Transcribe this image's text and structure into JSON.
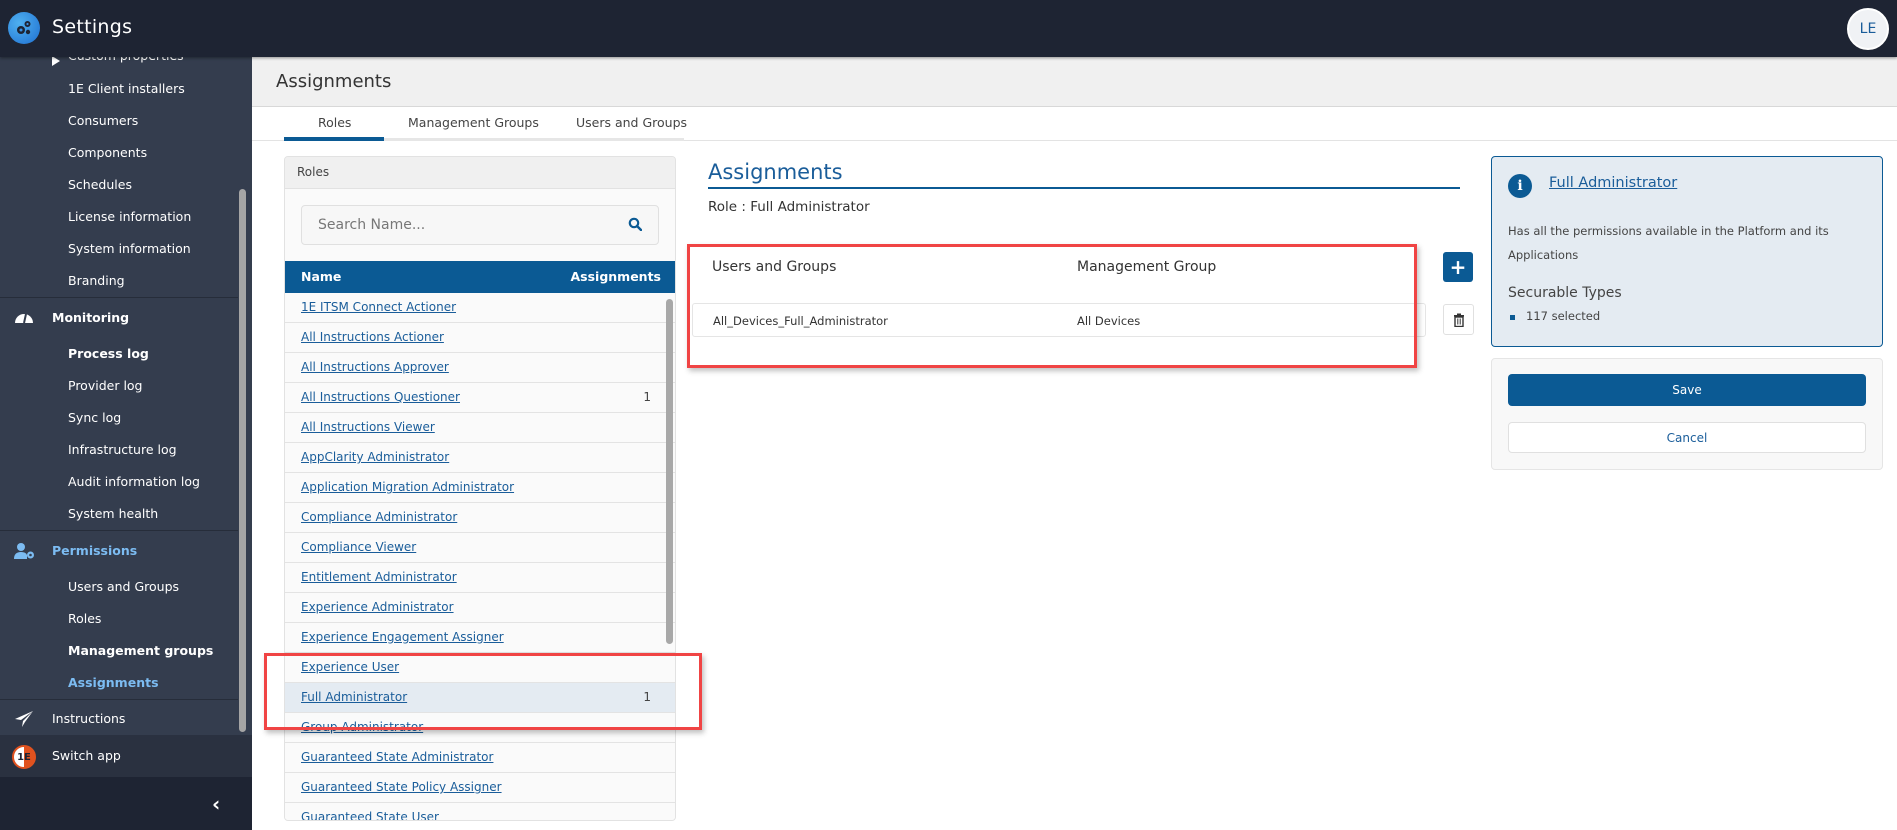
{
  "app": {
    "title": "Settings",
    "user_initials": "LE"
  },
  "sidebar": {
    "partial_item": "Custom properties",
    "settings_items": [
      "1E Client installers",
      "Consumers",
      "Components",
      "Schedules",
      "License information",
      "System information",
      "Branding"
    ],
    "monitoring": {
      "label": "Monitoring",
      "items": [
        "Process log",
        "Provider log",
        "Sync log",
        "Infrastructure log",
        "Audit information log",
        "System health"
      ]
    },
    "permissions": {
      "label": "Permissions",
      "items": [
        "Users and Groups",
        "Roles",
        "Management groups",
        "Assignments"
      ],
      "active_item": "Assignments"
    },
    "instructions_label": "Instructions",
    "switch_app_label": "Switch app",
    "collapse_icon": "chevron-left-icon"
  },
  "page": {
    "title": "Assignments",
    "tabs": [
      {
        "label": "Roles",
        "active": true
      },
      {
        "label": "Management Groups",
        "active": false
      },
      {
        "label": "Users and Groups",
        "active": false
      }
    ]
  },
  "roles_panel": {
    "title": "Roles",
    "search_placeholder": "Search Name...",
    "columns": {
      "name": "Name",
      "assignments": "Assignments"
    },
    "rows": [
      {
        "name": "1E ITSM Connect Actioner",
        "count": ""
      },
      {
        "name": "All Instructions Actioner",
        "count": ""
      },
      {
        "name": "All Instructions Approver",
        "count": ""
      },
      {
        "name": "All Instructions Questioner",
        "count": "1"
      },
      {
        "name": "All Instructions Viewer",
        "count": ""
      },
      {
        "name": "AppClarity Administrator",
        "count": ""
      },
      {
        "name": "Application Migration Administrator",
        "count": ""
      },
      {
        "name": "Compliance Administrator",
        "count": ""
      },
      {
        "name": "Compliance Viewer",
        "count": ""
      },
      {
        "name": "Entitlement Administrator",
        "count": ""
      },
      {
        "name": "Experience Administrator",
        "count": ""
      },
      {
        "name": "Experience Engagement Assigner",
        "count": ""
      },
      {
        "name": "Experience User",
        "count": ""
      },
      {
        "name": "Full Administrator",
        "count": "1",
        "selected": true
      },
      {
        "name": "Group Administrator",
        "count": ""
      },
      {
        "name": "Guaranteed State Administrator",
        "count": ""
      },
      {
        "name": "Guaranteed State Policy Assigner",
        "count": ""
      },
      {
        "name": "Guaranteed State User",
        "count": ""
      }
    ]
  },
  "assignments": {
    "title": "Assignments",
    "role_line": "Role : Full Administrator",
    "columns": {
      "users_groups": "Users and Groups",
      "management_group": "Management Group"
    },
    "rows": [
      {
        "users_groups": "All_Devices_Full_Administrator",
        "management_group": "All Devices"
      }
    ],
    "add_label": "+"
  },
  "info_card": {
    "title": "Full Administrator",
    "description": "Has all the permissions available in the Platform and its Applications",
    "section_label": "Securable Types",
    "selected_text": "117 selected"
  },
  "actions": {
    "save_label": "Save",
    "cancel_label": "Cancel"
  },
  "colors": {
    "brand": "#0b5a94",
    "header": "#1e2433",
    "sidebar": "#343d4e",
    "highlight": "#f04444",
    "active_nav": "#7cbcf2"
  }
}
